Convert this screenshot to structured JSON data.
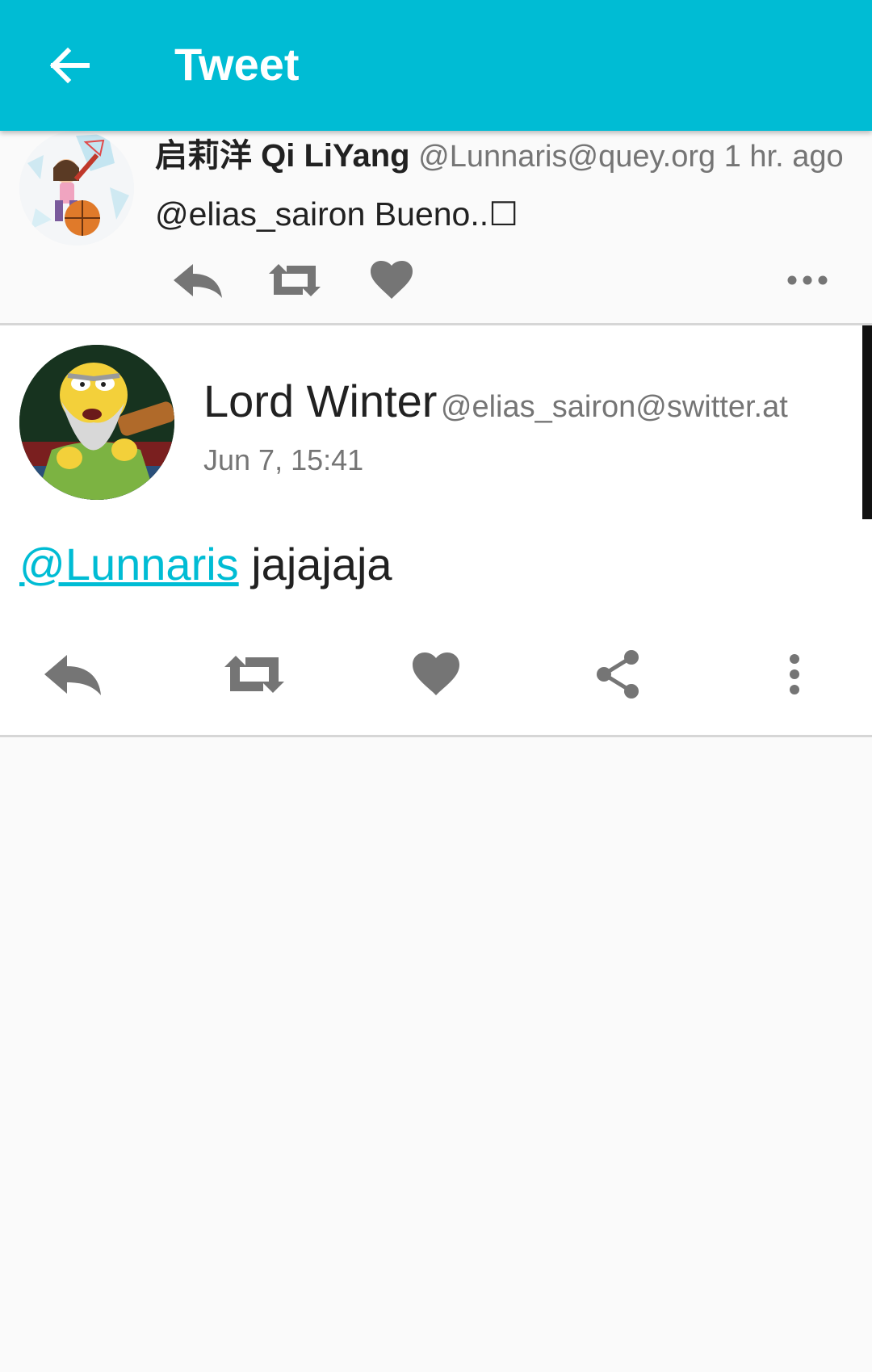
{
  "appbar": {
    "title": "Tweet",
    "back_icon": "arrow-back-icon",
    "color": "#00bcd4"
  },
  "parent_tweet": {
    "display_name": "启莉洋 Qi LiYang",
    "handle": "@Lunnaris@quey.org",
    "time": "1 hr. ago",
    "text": "@elias_sairon Bueno..☐",
    "actions": [
      "reply-icon",
      "retweet-icon",
      "favorite-icon",
      "more-horizontal-icon"
    ]
  },
  "main_tweet": {
    "display_name": "Lord Winter",
    "handle": "@elias_sairon@switter.at",
    "date": "Jun 7, 15:41",
    "mention": "@Lunnaris",
    "text": "jajajaja",
    "actions": [
      "reply-icon",
      "retweet-icon",
      "favorite-icon",
      "share-icon",
      "more-vertical-icon"
    ]
  },
  "colors": {
    "accent": "#00bcd4",
    "icon_gray": "#757575"
  }
}
